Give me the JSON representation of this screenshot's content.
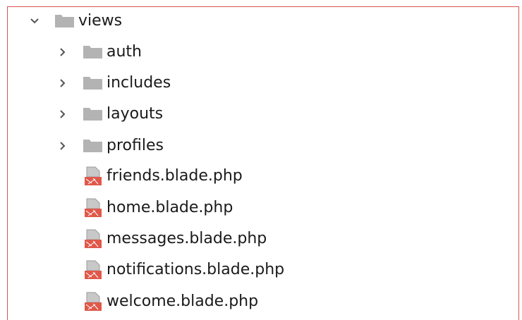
{
  "tree": {
    "root": {
      "label": "views",
      "icon": "folder-icon",
      "expanded": true
    },
    "folders": [
      {
        "label": "auth",
        "icon": "folder-icon",
        "expanded": false
      },
      {
        "label": "includes",
        "icon": "folder-icon",
        "expanded": false
      },
      {
        "label": "layouts",
        "icon": "folder-icon",
        "expanded": false
      },
      {
        "label": "profiles",
        "icon": "folder-icon",
        "expanded": false
      }
    ],
    "files": [
      {
        "label": "friends.blade.php",
        "icon": "blade-file-icon"
      },
      {
        "label": "home.blade.php",
        "icon": "blade-file-icon"
      },
      {
        "label": "messages.blade.php",
        "icon": "blade-file-icon"
      },
      {
        "label": "notifications.blade.php",
        "icon": "blade-file-icon"
      },
      {
        "label": "welcome.blade.php",
        "icon": "blade-file-icon"
      }
    ]
  },
  "colors": {
    "frame_border": "#d9534f",
    "folder_gray": "#b3b3b3",
    "blade_red": "#e0584a",
    "text": "#1a1a1a",
    "chevron": "#555555"
  }
}
